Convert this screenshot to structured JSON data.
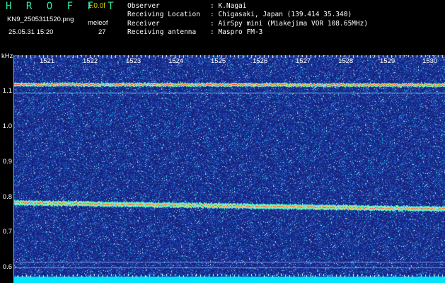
{
  "header": {
    "brand": "H R O F F T",
    "version": "1.0.0f",
    "file_name": "KN9_2505311520.png",
    "meteor_label": "meleof",
    "timestamp": "25.05.31 15:20",
    "count": "27"
  },
  "info": [
    {
      "key": "Observer",
      "value": ": K.Nagai"
    },
    {
      "key": "Receiving Location",
      "value": ": Chigasaki, Japan (139.414 35.340)"
    },
    {
      "key": "Receiver",
      "value": ": AirSpy mini (Miakejima VOR 108.65MHz)"
    },
    {
      "key": "Receiving antenna",
      "value": ": Maspro FM-3"
    }
  ],
  "axis": {
    "y_unit": "kHz",
    "y_ticks": [
      "1.1",
      "1.0",
      "0.9",
      "0.8",
      "0.7",
      "0.6"
    ],
    "x_ticks": [
      "1521",
      "1522",
      "1523",
      "1524",
      "1525",
      "1526",
      "1527",
      "1528",
      "1529",
      "1530"
    ]
  },
  "colors": {
    "background": "#000000",
    "noise_base": "#1a2a8c",
    "brand": "#33e6a0",
    "version": "#d8d800",
    "bottom_band": "#00e5ff"
  }
}
